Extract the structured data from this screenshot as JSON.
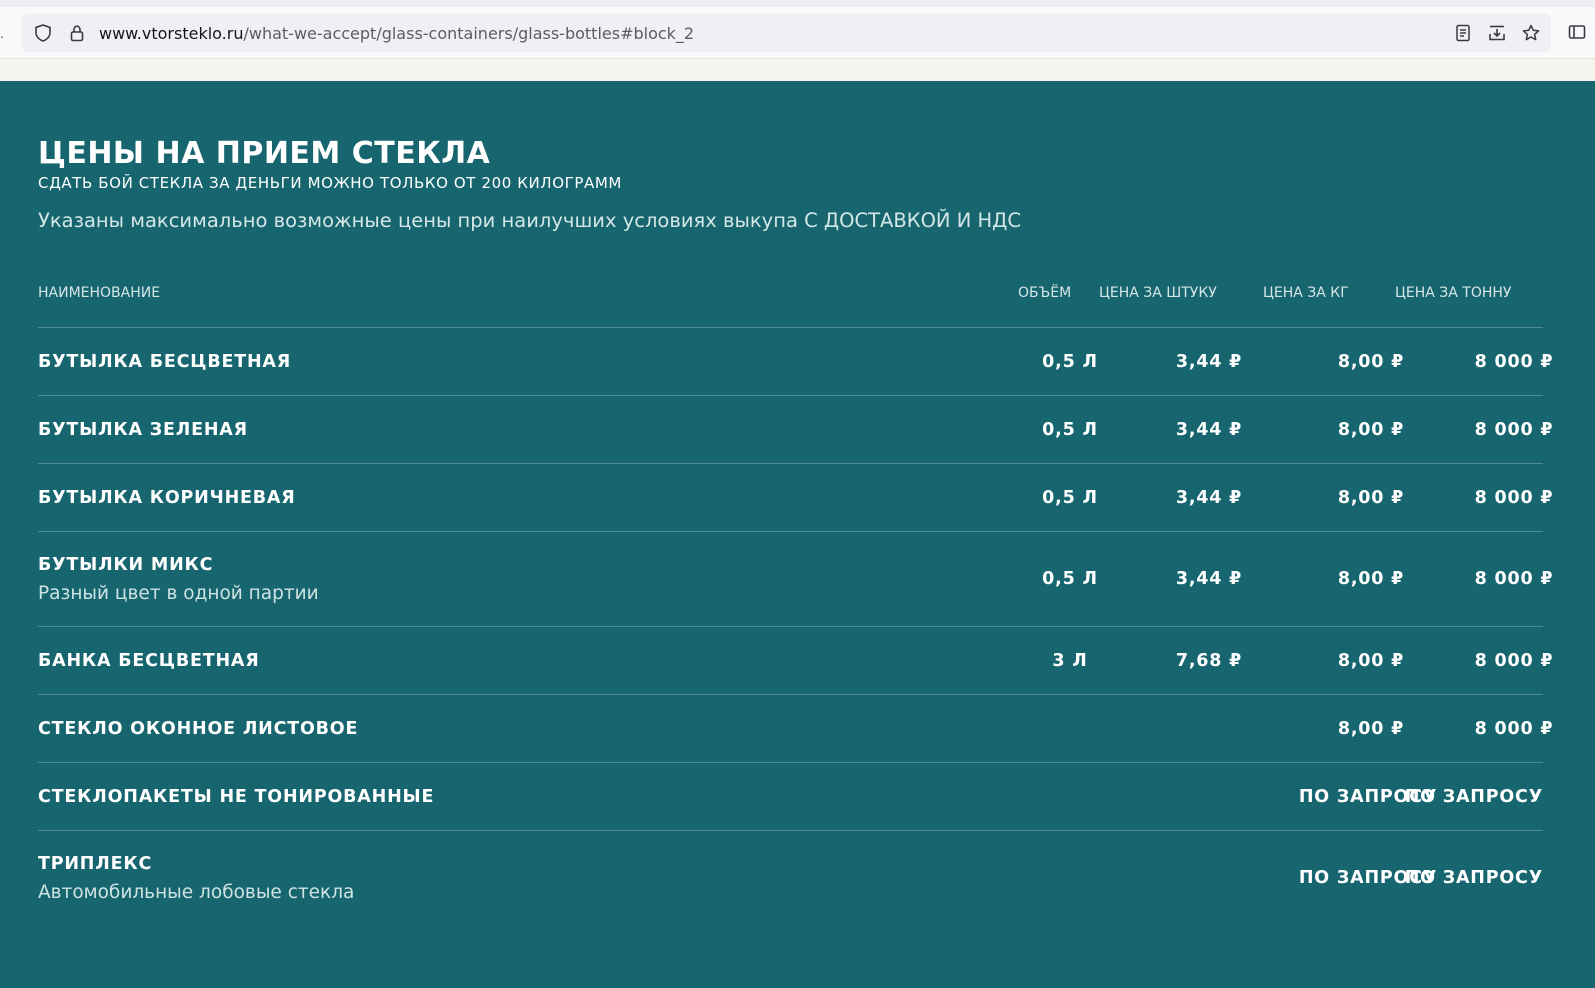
{
  "browser": {
    "url_host": "www.vtorsteklo.ru",
    "url_path": "/what-we-accept/glass-containers/glass-bottles#block_2"
  },
  "section": {
    "title": "ЦЕНЫ НА ПРИЕМ СТЕКЛА",
    "subtitle": "СДАТЬ БОЙ СТЕКЛА ЗА ДЕНЬГИ МОЖНО ТОЛЬКО ОТ 200 КИЛОГРАММ",
    "note": "Указаны максимально возможные цены при наилучших условиях выкупа С ДОСТАВКОЙ И НДС"
  },
  "table": {
    "headers": {
      "name": "НАИМЕНОВАНИЕ",
      "volume": "ОБЪЁМ",
      "price_piece": "ЦЕНА ЗА ШТУКУ",
      "price_kg": "ЦЕНА ЗА КГ",
      "price_ton": "ЦЕНА ЗА ТОННУ"
    },
    "rows": [
      {
        "name": "БУТЫЛКА БЕСЦВЕТНАЯ",
        "volume": "0,5 Л",
        "price_piece": "3,44 ₽",
        "price_kg": "8,00 ₽",
        "price_ton": "8 000 ₽"
      },
      {
        "name": "БУТЫЛКА ЗЕЛЕНАЯ",
        "volume": "0,5 Л",
        "price_piece": "3,44 ₽",
        "price_kg": "8,00 ₽",
        "price_ton": "8 000 ₽"
      },
      {
        "name": "БУТЫЛКА КОРИЧНЕВАЯ",
        "volume": "0,5 Л",
        "price_piece": "3,44 ₽",
        "price_kg": "8,00 ₽",
        "price_ton": "8 000 ₽"
      },
      {
        "name": "БУТЫЛКИ МИКС",
        "description": "Разный цвет в одной партии",
        "volume": "0,5 Л",
        "price_piece": "3,44 ₽",
        "price_kg": "8,00 ₽",
        "price_ton": "8 000 ₽"
      },
      {
        "name": "БАНКА БЕСЦВЕТНАЯ",
        "volume": "3 Л",
        "price_piece": "7,68 ₽",
        "price_kg": "8,00 ₽",
        "price_ton": "8 000 ₽"
      },
      {
        "name": "СТЕКЛО ОКОННОЕ ЛИСТОВОЕ",
        "price_kg": "8,00 ₽",
        "price_ton": "8 000 ₽"
      },
      {
        "name": "СТЕКЛОПАКЕТЫ НЕ ТОНИРОВАННЫЕ",
        "price_kg": "ПО ЗАПРОСУ",
        "price_ton": "ПО ЗАПРОСУ"
      },
      {
        "name": "ТРИПЛЕКС",
        "description": "Автомобильные лобовые стекла",
        "price_kg": "ПО ЗАПРОСУ",
        "price_ton": "ПО ЗАПРОСУ"
      }
    ]
  }
}
